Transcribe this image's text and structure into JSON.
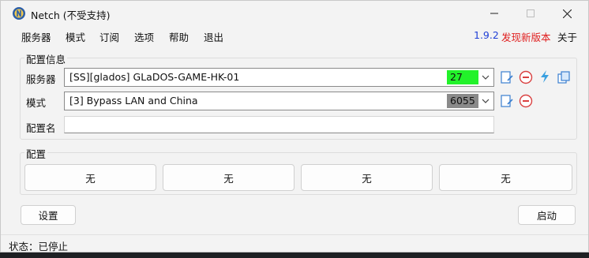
{
  "window": {
    "title": "Netch (不受支持)"
  },
  "menu": {
    "items": [
      "服务器",
      "模式",
      "订阅",
      "选项",
      "帮助",
      "退出"
    ],
    "version": "1.9.2",
    "new_version": "发现新版本",
    "about": "关于"
  },
  "config": {
    "group_title": "配置信息",
    "server_label": "服务器",
    "server_value": "[SS][glados] GLaDOS-GAME-HK-01",
    "server_latency": "27",
    "server_latency_color": "#22f22a",
    "mode_label": "模式",
    "mode_value": "[3] Bypass LAN and China",
    "mode_badge": "6055",
    "mode_badge_color": "#8a8a8a",
    "profile_label": "配置名",
    "profile_value": ""
  },
  "profiles": {
    "group_title": "配置",
    "buttons": [
      "无",
      "无",
      "无",
      "无"
    ]
  },
  "actions": {
    "settings_label": "设置",
    "start_label": "启动"
  },
  "status": {
    "text": "状态：已停止"
  },
  "colors": {
    "accent_blue": "#1f3fd6",
    "accent_red": "#e01f1f",
    "window_bg": "#f3f3f3"
  },
  "icons": [
    "netch-app-icon",
    "minimize-icon",
    "maximize-icon",
    "close-icon",
    "edit-icon",
    "delete-icon",
    "speedtest-icon",
    "copy-icon",
    "chevron-down-icon"
  ]
}
